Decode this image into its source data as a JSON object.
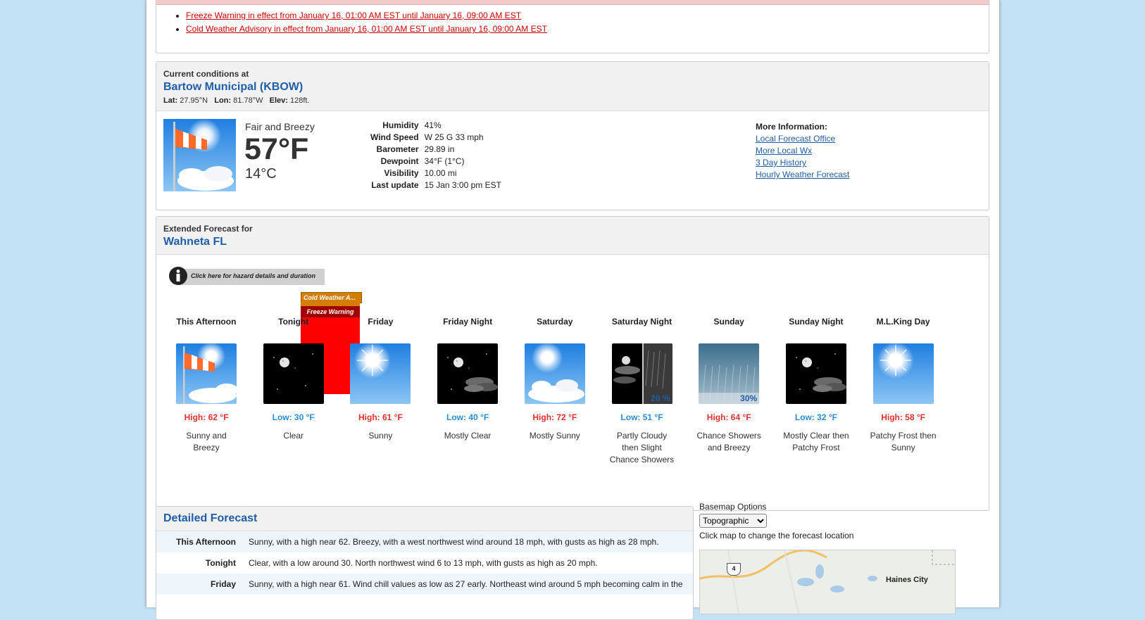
{
  "hazards": [
    "Freeze Warning in effect from January 16, 01:00 AM EST until January 16, 09:00 AM EST",
    "Cold Weather Advisory in effect from January 16, 01:00 AM EST until January 16, 09:00 AM EST"
  ],
  "current": {
    "heading": "Current conditions at",
    "station": "Bartow Municipal (KBOW)",
    "lat_label": "Lat:",
    "lat": "27.95°N",
    "lon_label": "Lon:",
    "lon": "81.78°W",
    "elev_label": "Elev:",
    "elev": "128ft.",
    "summary": "Fair and Breezy",
    "temp_f": "57°F",
    "temp_c": "14°C",
    "details": [
      {
        "label": "Humidity",
        "value": "41%"
      },
      {
        "label": "Wind Speed",
        "value": "W 25 G 33 mph"
      },
      {
        "label": "Barometer",
        "value": "29.89 in"
      },
      {
        "label": "Dewpoint",
        "value": "34°F (1°C)"
      },
      {
        "label": "Visibility",
        "value": "10.00 mi"
      },
      {
        "label": "Last update",
        "value": "15 Jan 3:00 pm EST"
      }
    ],
    "more_heading": "More Information:",
    "more_links": [
      "Local Forecast Office",
      "More Local Wx",
      "3 Day History",
      "Hourly Weather Forecast"
    ]
  },
  "extended": {
    "heading": "Extended Forecast for",
    "location": "Wahneta FL",
    "hazard_link": "Click here for hazard details and duration",
    "hazard_cold": "Cold Weather A...",
    "hazard_freeze": "Freeze Warning",
    "periods": [
      {
        "name": "This Afternoon",
        "temp": "High: 62 °F",
        "kind": "hi",
        "desc": "Sunny and Breezy",
        "icon": "windy-day-icon",
        "pct": ""
      },
      {
        "name": "Tonight",
        "temp": "Low: 30 °F",
        "kind": "lo",
        "desc": "Clear",
        "icon": "clear-night-icon",
        "pct": ""
      },
      {
        "name": "Friday",
        "temp": "High: 61 °F",
        "kind": "hi",
        "desc": "Sunny",
        "icon": "sunny-icon",
        "pct": ""
      },
      {
        "name": "Friday Night",
        "temp": "Low: 40 °F",
        "kind": "lo",
        "desc": "Mostly Clear",
        "icon": "mostly-clear-night-icon",
        "pct": ""
      },
      {
        "name": "Saturday",
        "temp": "High: 72 °F",
        "kind": "hi",
        "desc": "Mostly Sunny",
        "icon": "mostly-sunny-icon",
        "pct": ""
      },
      {
        "name": "Saturday Night",
        "temp": "Low: 51 °F",
        "kind": "lo",
        "desc": "Partly Cloudy then Slight Chance Showers",
        "icon": "partly-cloudy-showers-night-icon",
        "pct": "20 %"
      },
      {
        "name": "Sunday",
        "temp": "High: 64 °F",
        "kind": "hi",
        "desc": "Chance Showers and Breezy",
        "icon": "showers-icon",
        "pct": "30%"
      },
      {
        "name": "Sunday Night",
        "temp": "Low: 32 °F",
        "kind": "lo",
        "desc": "Mostly Clear then Patchy Frost",
        "icon": "mostly-clear-night-icon",
        "pct": ""
      },
      {
        "name": "M.L.King Day",
        "temp": "High: 58 °F",
        "kind": "hi",
        "desc": "Patchy Frost then Sunny",
        "icon": "sunny-icon",
        "pct": ""
      }
    ]
  },
  "detailed": {
    "heading": "Detailed Forecast",
    "rows": [
      {
        "period": "This Afternoon",
        "text": "Sunny, with a high near 62. Breezy, with a west northwest wind around 18 mph, with gusts as high as 28 mph."
      },
      {
        "period": "Tonight",
        "text": "Clear, with a low around 30. North northwest wind 6 to 13 mph, with gusts as high as 20 mph."
      },
      {
        "period": "Friday",
        "text": "Sunny, with a high near 61. Wind chill values as low as 27 early. Northeast wind around 5 mph becoming calm in the"
      }
    ]
  },
  "map": {
    "basemap_label": "Basemap Options",
    "basemap_value": "Topographic",
    "hint": "Click map to change the forecast location",
    "route_label": "4",
    "city_label": "Haines City"
  }
}
